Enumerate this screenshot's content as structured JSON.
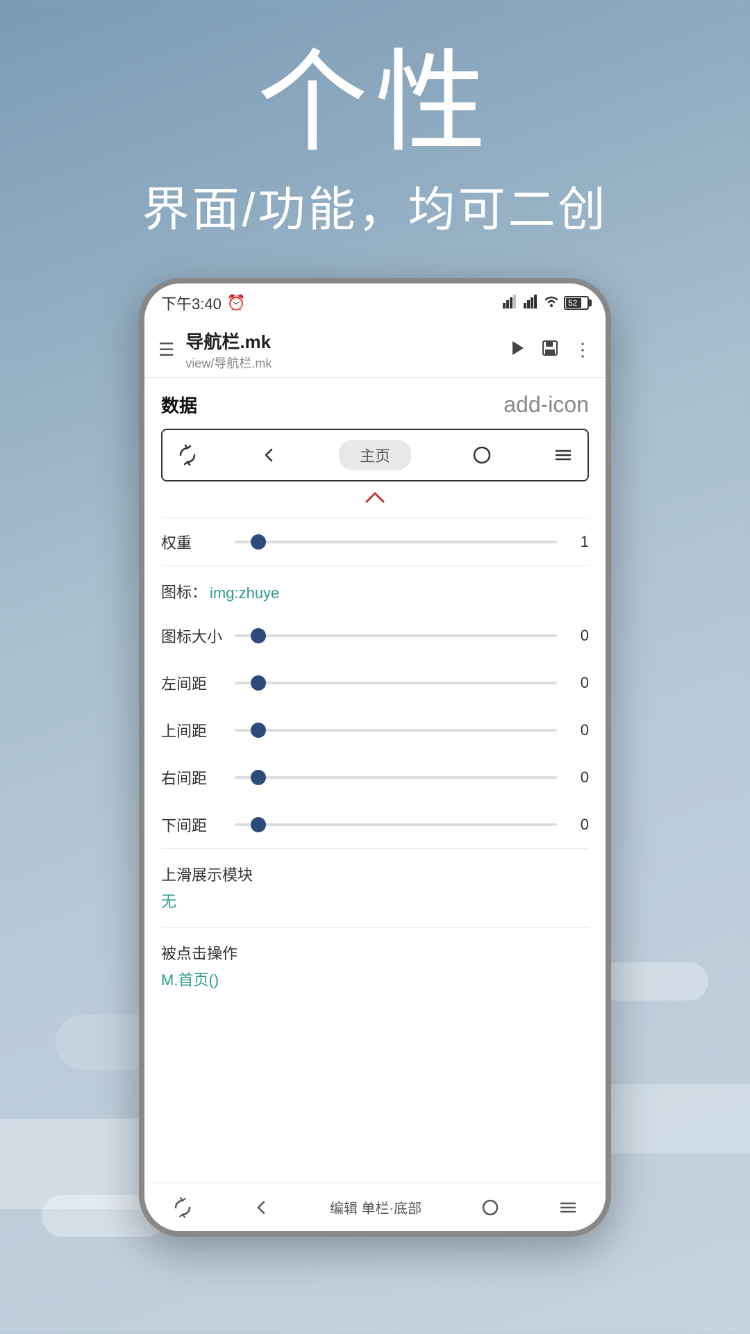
{
  "hero": {
    "main_text": "个性",
    "sub_text": "界面/功能，均可二创"
  },
  "status_bar": {
    "time": "下午3:40",
    "battery_level": "52",
    "alarm_icon": "alarm-icon",
    "signal_icons": "signal-icon",
    "wifi_icon": "wifi-icon",
    "battery_icon": "battery-icon"
  },
  "title_bar": {
    "menu_icon": "menu-icon",
    "file_name": "导航栏.mk",
    "file_path": "view/导航栏.mk",
    "play_icon": "play-icon",
    "save_icon": "save-icon",
    "more_icon": "more-icon"
  },
  "content": {
    "section_title": "数据",
    "add_icon": "add-icon",
    "nav_preview": {
      "back_icon": "back-icon",
      "refresh_icon": "refresh-icon",
      "home_label": "主页",
      "circle_icon": "circle-icon",
      "menu_icon": "nav-menu-icon"
    },
    "expand_icon": "chevron-up-icon",
    "weight_label": "权重",
    "weight_value": "1",
    "weight_thumb_pos": "5%",
    "icon_section": {
      "label": "图标：",
      "value": "img:zhuye"
    },
    "icon_size": {
      "label": "图标大小",
      "value": "0",
      "thumb_pos": "5%"
    },
    "left_margin": {
      "label": "左间距",
      "value": "0",
      "thumb_pos": "5%"
    },
    "top_margin": {
      "label": "上间距",
      "value": "0",
      "thumb_pos": "5%"
    },
    "right_margin": {
      "label": "右间距",
      "value": "0",
      "thumb_pos": "5%"
    },
    "bottom_margin": {
      "label": "下间距",
      "value": "0",
      "thumb_pos": "5%"
    },
    "slide_module": {
      "label": "上滑展示模块",
      "value": "无"
    },
    "click_action": {
      "label": "被点击操作",
      "value": "M.首页()"
    }
  },
  "bottom_nav": {
    "refresh_icon": "bottom-refresh-icon",
    "back_icon": "bottom-back-icon",
    "label": "编辑 单栏·底部",
    "home_icon": "bottom-home-icon",
    "menu_icon": "bottom-menu-icon"
  }
}
